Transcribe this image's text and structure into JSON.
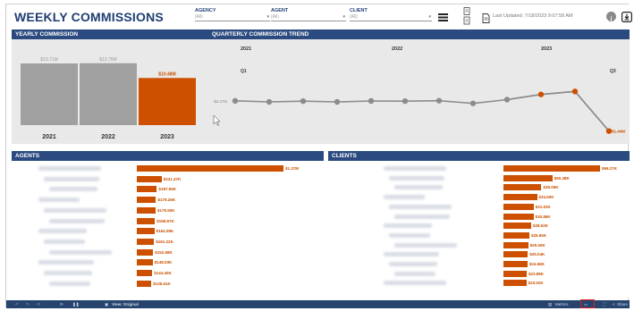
{
  "header": {
    "title": "WEEKLY COMMISSIONS",
    "filters": [
      {
        "label": "AGENCY",
        "value": "(All)"
      },
      {
        "label": "AGENT",
        "value": "(All)"
      },
      {
        "label": "CLIENT",
        "value": "(All)"
      }
    ],
    "last_updated": "Last Updated: 7/18/2023 9:07:58 AM",
    "icons": [
      "menu-icon",
      "download-files-icon",
      "document-icon",
      "info-icon",
      "export-icon"
    ]
  },
  "yearly": {
    "title": "YEARLY COMMISSION",
    "bars": [
      {
        "year": "2021",
        "label": "$13.71M",
        "value": 13.71,
        "color": "#a0a0a0"
      },
      {
        "year": "2022",
        "label": "$13.76M",
        "value": 13.76,
        "color": "#a0a0a0"
      },
      {
        "year": "2023",
        "label": "$10.48M",
        "value": 10.48,
        "color": "#cc5000"
      }
    ]
  },
  "trend": {
    "title": "QUARTERLY COMMISSION TREND",
    "years": [
      "2021",
      "2022",
      "2023"
    ],
    "quarters": [
      {
        "text": "Q1"
      },
      {
        "text": "Q3"
      }
    ],
    "start_label": "$3.47M",
    "end_label": "$1.44M",
    "points": [
      3.47,
      3.4,
      3.45,
      3.4,
      3.46,
      3.45,
      3.48,
      3.3,
      3.55,
      3.9,
      4.1,
      1.44
    ],
    "highlight_from": 9,
    "ylim": [
      1.0,
      5.2
    ]
  },
  "agents": {
    "title": "AGENTS",
    "bars": [
      {
        "label": "$1.37M",
        "value": 1370
      },
      {
        "label": "$231.47K",
        "value": 231.47
      },
      {
        "label": "$187.65K",
        "value": 187.65
      },
      {
        "label": "$179.26K",
        "value": 179.26
      },
      {
        "label": "$175.50K",
        "value": 175.5
      },
      {
        "label": "$168.67K",
        "value": 168.67
      },
      {
        "label": "$164.08K",
        "value": 164.08
      },
      {
        "label": "$161.22K",
        "value": 161.22
      },
      {
        "label": "$152.68K",
        "value": 152.68
      },
      {
        "label": "$148.03K",
        "value": 148.03
      },
      {
        "label": "$144.40K",
        "value": 144.4
      },
      {
        "label": "$135.61K",
        "value": 135.61
      }
    ]
  },
  "clients": {
    "title": "CLIENTS",
    "bars": [
      {
        "label": "$99.27K",
        "value": 99.27
      },
      {
        "label": "$50.38K",
        "value": 50.38
      },
      {
        "label": "$39.05K",
        "value": 39.05
      },
      {
        "label": "$34.50K",
        "value": 34.5
      },
      {
        "label": "$31.02K",
        "value": 31.02
      },
      {
        "label": "$30.86K",
        "value": 30.86
      },
      {
        "label": "$28.52K",
        "value": 28.52
      },
      {
        "label": "$26.65K",
        "value": 26.65
      },
      {
        "label": "$25.50K",
        "value": 25.5
      },
      {
        "label": "$25.04K",
        "value": 25.04
      },
      {
        "label": "$24.68K",
        "value": 24.68
      },
      {
        "label": "$23.89K",
        "value": 23.89
      },
      {
        "label": "$23.52K",
        "value": 23.52
      }
    ]
  },
  "bottombar": {
    "view_label": "View: Original",
    "metrics_label": "Metrics",
    "share_label": "Share"
  },
  "colors": {
    "accent": "#cc5000",
    "header_bg": "#2b4a80",
    "gray_bar": "#a0a0a0",
    "title": "#1f3e73"
  }
}
